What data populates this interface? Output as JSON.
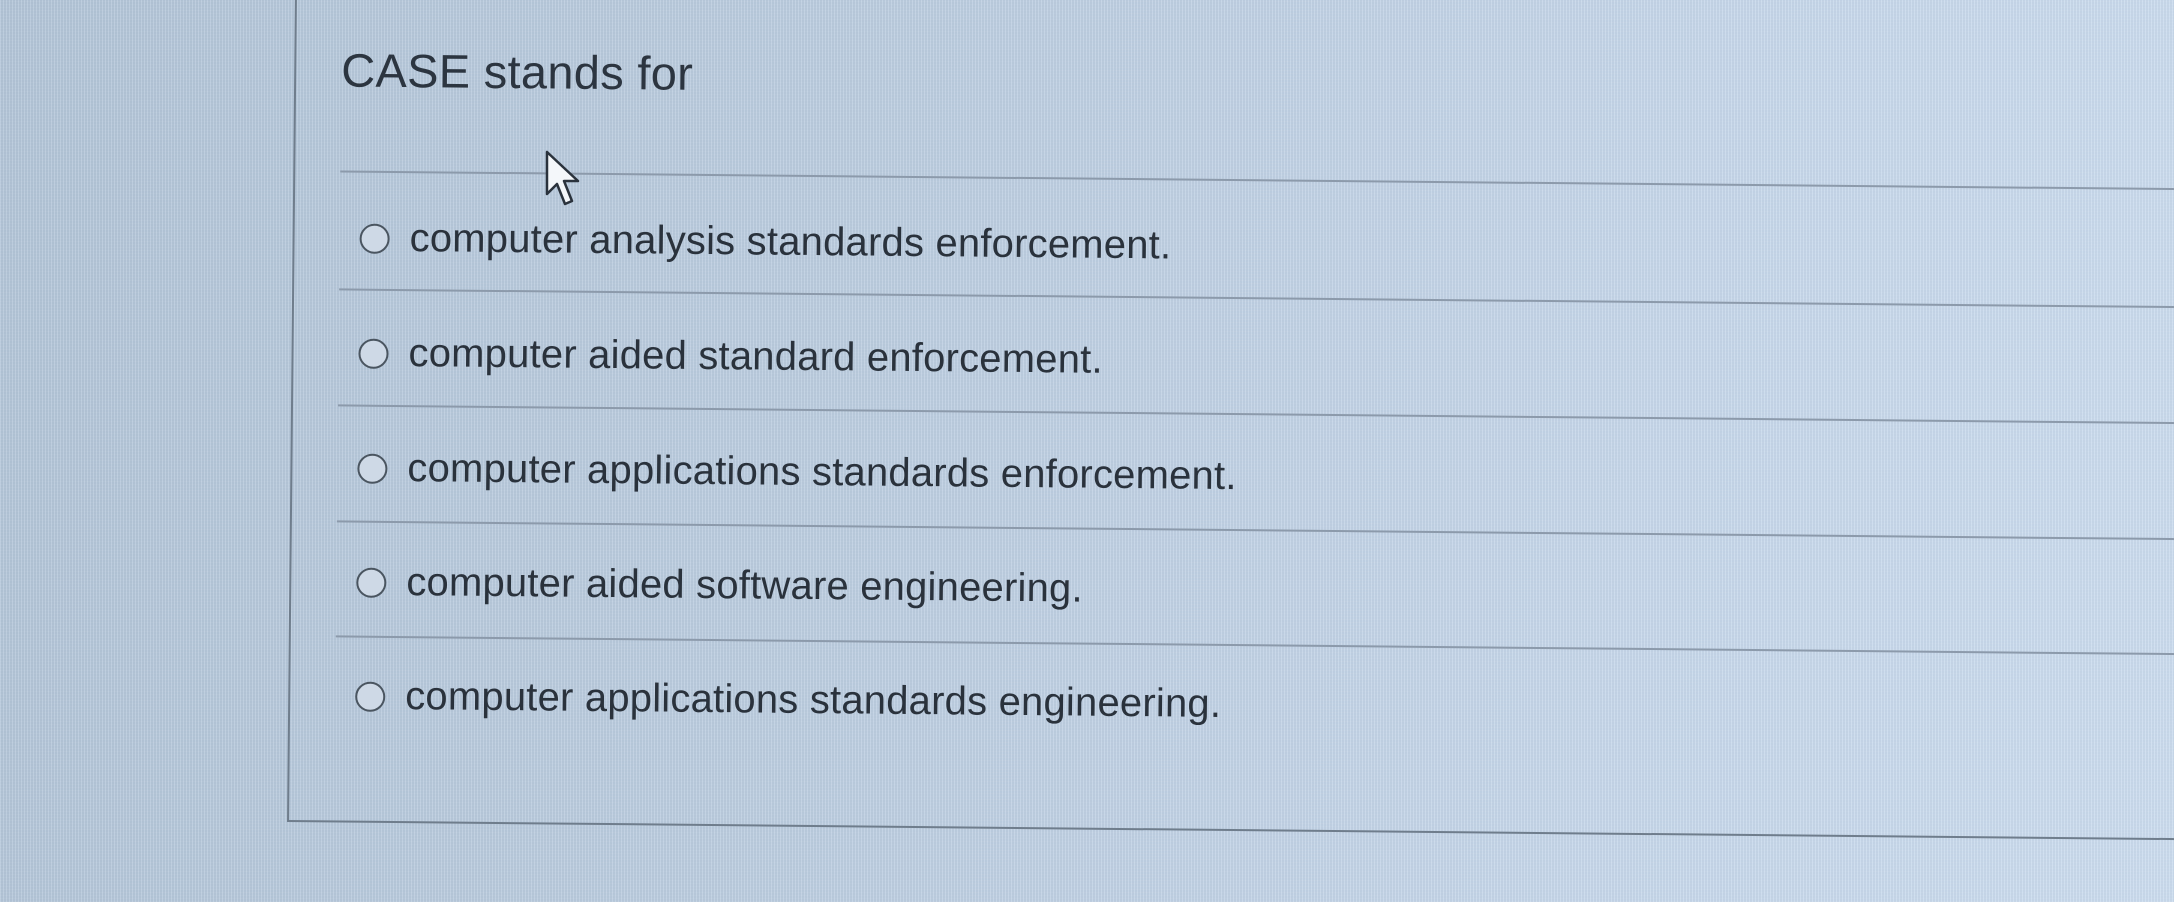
{
  "question": {
    "text": "CASE stands for"
  },
  "options": [
    {
      "label": "computer analysis standards enforcement."
    },
    {
      "label": "computer aided standard enforcement."
    },
    {
      "label": "computer applications standards enforcement."
    },
    {
      "label": "computer aided software engineering."
    },
    {
      "label": "computer applications standards engineering."
    }
  ],
  "icons": {
    "cursor": "mouse-pointer-icon",
    "radio": "radio-button"
  },
  "colors": {
    "background": "#bccde0",
    "text": "#2a323c",
    "divider": "#8c9aab"
  }
}
